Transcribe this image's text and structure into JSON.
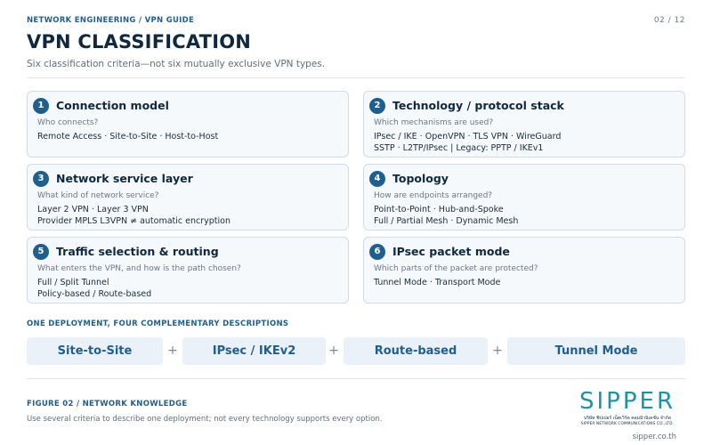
{
  "header": {
    "kicker": "NETWORK ENGINEERING / VPN GUIDE",
    "page": "02 / 12",
    "title": "VPN CLASSIFICATION",
    "subtitle": "Six classification criteria—not six mutually exclusive VPN types."
  },
  "cards": [
    {
      "num": "1",
      "title": "Connection model",
      "question": "Who connects?",
      "line1": "Remote Access · Site-to-Site · Host-to-Host",
      "line2": ""
    },
    {
      "num": "2",
      "title": "Technology / protocol stack",
      "question": "Which mechanisms are used?",
      "line1": "IPsec / IKE · OpenVPN · TLS VPN · WireGuard",
      "line2": "SSTP · L2TP/IPsec | Legacy: PPTP / IKEv1"
    },
    {
      "num": "3",
      "title": "Network service layer",
      "question": "What kind of network service?",
      "line1": "Layer 2 VPN · Layer 3 VPN",
      "line2": "Provider MPLS L3VPN ≠ automatic encryption"
    },
    {
      "num": "4",
      "title": "Topology",
      "question": "How are endpoints arranged?",
      "line1": "Point-to-Point · Hub-and-Spoke",
      "line2": "Full / Partial Mesh · Dynamic Mesh"
    },
    {
      "num": "5",
      "title": "Traffic selection & routing",
      "question": "What enters the VPN, and how is the path chosen?",
      "line1": "Full / Split Tunnel",
      "line2": "Policy-based / Route-based"
    },
    {
      "num": "6",
      "title": "IPsec packet mode",
      "question": "Which parts of the packet are protected?",
      "line1": "Tunnel Mode · Transport Mode",
      "line2": ""
    }
  ],
  "deployment": {
    "heading": "ONE DEPLOYMENT, FOUR COMPLEMENTARY DESCRIPTIONS",
    "items": [
      "Site-to-Site",
      "IPsec / IKEv2",
      "Route-based",
      "Tunnel Mode"
    ],
    "separator": "+"
  },
  "footer": {
    "figure": "FIGURE 02 / NETWORK KNOWLEDGE",
    "caption": "Use several criteria to describe one deployment; not every technology supports every option.",
    "website": "sipper.co.th"
  },
  "logo": {
    "word": "SIPPER",
    "thai": "บริษัท ซิปเปอร์ เน็ตเวิร์ค คอมมิวนิเคชั่น จำกัด",
    "english": "SIPPER NETWORK COMMUNICATIONS CO.,LTD."
  },
  "colors": {
    "accent": "#1f5f8f",
    "title": "#0f2840",
    "card_bg": "#f6f9fc",
    "card_border": "#cfdbe6",
    "pill_bg": "#eaf1f8",
    "logo_teal": "#1a93a6"
  }
}
